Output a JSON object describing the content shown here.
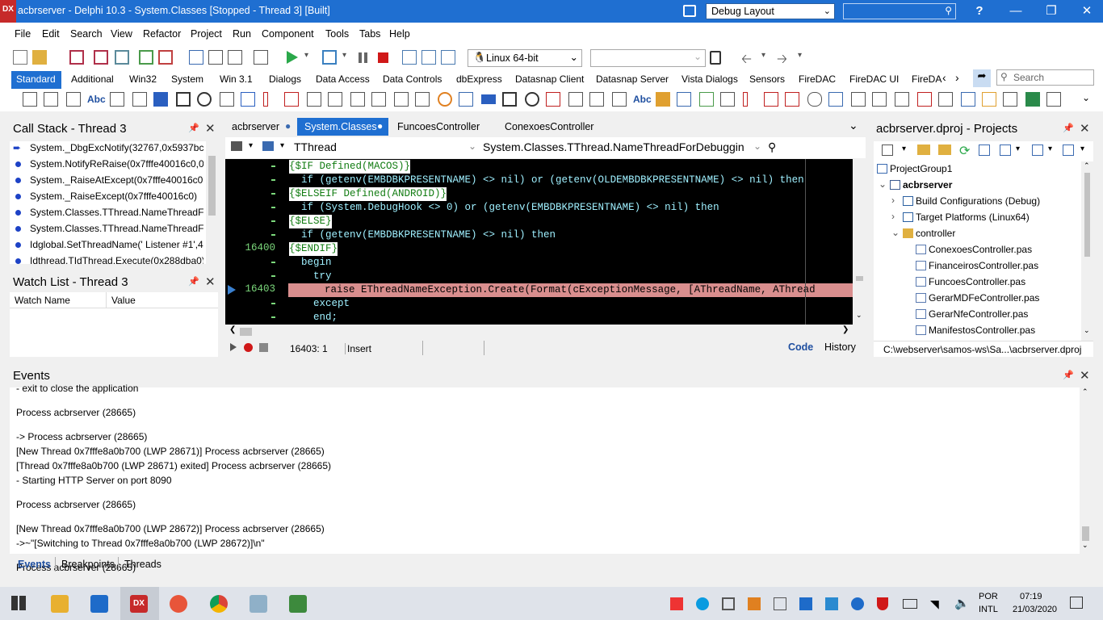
{
  "window": {
    "title": "acbrserver - Delphi 10.3 - System.Classes [Stopped - Thread 3] [Built]",
    "logo": "DX",
    "layout": "Debug Layout",
    "help": "?"
  },
  "menu": [
    "File",
    "Edit",
    "Search",
    "View",
    "Refactor",
    "Project",
    "Run",
    "Component",
    "Tools",
    "Tabs",
    "Help"
  ],
  "toolbar": {
    "platform": "Linux 64-bit",
    "config": ""
  },
  "palette": {
    "tabs": [
      "Standard",
      "Additional",
      "Win32",
      "System",
      "Win 3.1",
      "Dialogs",
      "Data Access",
      "Data Controls",
      "dbExpress",
      "Datasnap Client",
      "Datasnap Server",
      "Vista Dialogs",
      "Sensors",
      "FireDAC",
      "FireDAC UI",
      "FireDA"
    ],
    "active": "Standard",
    "search_placeholder": "Search"
  },
  "callstack": {
    "title": "Call Stack - Thread 3",
    "rows": [
      "System._DbgExcNotify(32767,0x5937bc,0",
      "System.NotifyReRaise(0x7fffe40016c0,0x:",
      "System._RaiseAtExcept(0x7fffe40016c0,0:",
      "System._RaiseExcept(0x7fffe40016c0)",
      "System.Classes.TThread.NameThreadFor",
      "System.Classes.TThread.NameThreadFor",
      "Idglobal.SetThreadName(' Listener #1',42",
      "Idthread.TIdThread.Execute(0x288dba0)"
    ]
  },
  "watch": {
    "title": "Watch List - Thread 3",
    "col_name": "Watch Name",
    "col_value": "Value"
  },
  "editor": {
    "tabs": [
      "acbrserver",
      "System.Classes",
      "FuncoesController",
      "ConexoesController"
    ],
    "active_tab": "System.Classes",
    "class_combo": "TThread",
    "method_combo": "System.Classes.TThread.NameThreadForDebuggin",
    "lines": [
      {
        "num": "",
        "text": "{$IF Defined(MACOS)}",
        "kind": "dir"
      },
      {
        "num": "",
        "text": "  if (getenv(EMBDBKPRESENTNAME) <> nil) or (getenv(OLDEMBDBKPRESENTNAME) <> nil) then",
        "kind": "code"
      },
      {
        "num": "",
        "text": "{$ELSEIF Defined(ANDROID)}",
        "kind": "dir"
      },
      {
        "num": "",
        "text": "  if (System.DebugHook <> 0) or (getenv(EMBDBKPRESENTNAME) <> nil) then",
        "kind": "code"
      },
      {
        "num": "",
        "text": "{$ELSE}",
        "kind": "dir"
      },
      {
        "num": "",
        "text": "  if (getenv(EMBDBKPRESENTNAME) <> nil) then",
        "kind": "code"
      },
      {
        "num": "16400",
        "text": "{$ENDIF}",
        "kind": "dir"
      },
      {
        "num": "",
        "text": "  begin",
        "kind": "code"
      },
      {
        "num": "",
        "text": "    try",
        "kind": "code"
      },
      {
        "num": "16403",
        "text": "      raise EThreadNameException.Create(Format(cExceptionMessage, [AThreadName, AThread",
        "kind": "exec"
      },
      {
        "num": "",
        "text": "    except",
        "kind": "code"
      },
      {
        "num": "",
        "text": "    end;",
        "kind": "code"
      }
    ],
    "status_pos": "16403:  1",
    "status_mode": "Insert",
    "view_code": "Code",
    "view_history": "History"
  },
  "projects": {
    "title": "acbrserver.dproj - Projects",
    "nodes": [
      {
        "label": "ProjectGroup1",
        "indent": 0,
        "bold": false
      },
      {
        "label": "acbrserver",
        "indent": 1,
        "bold": true
      },
      {
        "label": "Build Configurations (Debug)",
        "indent": 2,
        "bold": false
      },
      {
        "label": "Target Platforms (Linux64)",
        "indent": 2,
        "bold": false
      },
      {
        "label": "controller",
        "indent": 2,
        "bold": false
      },
      {
        "label": "ConexoesController.pas",
        "indent": 3,
        "bold": false
      },
      {
        "label": "FinanceirosController.pas",
        "indent": 3,
        "bold": false
      },
      {
        "label": "FuncoesController.pas",
        "indent": 3,
        "bold": false
      },
      {
        "label": "GerarMDFeController.pas",
        "indent": 3,
        "bold": false
      },
      {
        "label": "GerarNfeController.pas",
        "indent": 3,
        "bold": false
      },
      {
        "label": "ManifestosController.pas",
        "indent": 3,
        "bold": false
      }
    ],
    "path": "C:\\webserver\\samos-ws\\Sa...\\acbrserver.dproj"
  },
  "events": {
    "title": "Events",
    "lines": [
      "  - exit  to close the application",
      "",
      "Process acbrserver (28665)",
      "",
      "-> Process acbrserver (28665)",
      "[New Thread 0x7fffe8a0b700 (LWP 28671)]  Process acbrserver (28665)",
      "[Thread 0x7fffe8a0b700 (LWP 28671) exited]  Process acbrserver (28665)",
      "- Starting HTTP Server on port 8090",
      "",
      "Process acbrserver (28665)",
      "",
      "[New Thread 0x7fffe8a0b700 (LWP 28672)]  Process acbrserver (28665)",
      "->~\"[Switching to Thread 0x7fffe8a0b700 (LWP 28672)]\\n\"",
      "",
      "Process acbrserver (28665)"
    ],
    "tabs": [
      "Events",
      "Breakpoints",
      "Threads"
    ],
    "active_tab": "Events"
  },
  "taskbar": {
    "lang1": "POR",
    "lang2": "INTL",
    "time": "07:19",
    "date": "21/03/2020"
  }
}
